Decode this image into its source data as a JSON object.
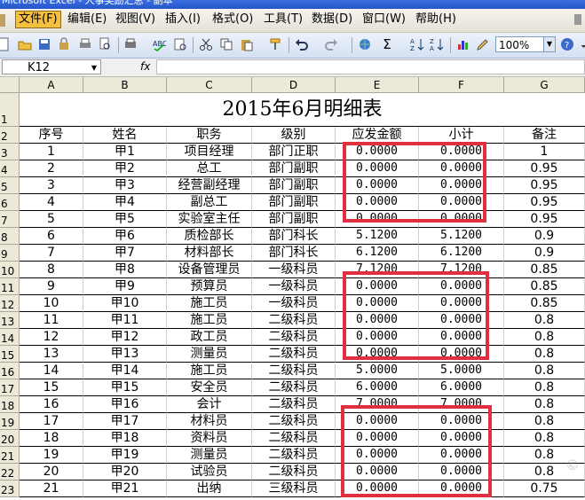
{
  "app": {
    "title": "Microsoft Excel - 人事奖励汇总 - 副本"
  },
  "menu": [
    "文件(F)",
    "编辑(E)",
    "视图(V)",
    "插入(I)",
    "格式(O)",
    "工具(T)",
    "数据(D)",
    "窗口(W)",
    "帮助(H)"
  ],
  "toolbar": {
    "zoom": "100%"
  },
  "formula": {
    "name_box": "K12",
    "fx": "fx",
    "value": ""
  },
  "columns": [
    "A",
    "B",
    "C",
    "D",
    "E",
    "F",
    "G"
  ],
  "sheet": {
    "title": "2015年6月明细表",
    "headers": [
      "序号",
      "姓名",
      "职务",
      "级别",
      "应发金额",
      "小计",
      "备注"
    ],
    "rows": [
      [
        "1",
        "甲1",
        "项目经理",
        "部门正职",
        "0.0000",
        "0.0000",
        "1"
      ],
      [
        "2",
        "甲2",
        "总工",
        "部门副职",
        "0.0000",
        "0.0000",
        "0.95"
      ],
      [
        "3",
        "甲3",
        "经营副经理",
        "部门副职",
        "0.0000",
        "0.0000",
        "0.95"
      ],
      [
        "4",
        "甲4",
        "副总工",
        "部门副职",
        "0.0000",
        "0.0000",
        "0.95"
      ],
      [
        "5",
        "甲5",
        "实验室主任",
        "部门副职",
        "0.0000",
        "0.0000",
        "0.95"
      ],
      [
        "6",
        "甲6",
        "质检部长",
        "部门科长",
        "5.1200",
        "5.1200",
        "0.9"
      ],
      [
        "7",
        "甲7",
        "材料部长",
        "部门科长",
        "6.1200",
        "6.1200",
        "0.9"
      ],
      [
        "8",
        "甲8",
        "设备管理员",
        "一级科员",
        "7.1200",
        "7.1200",
        "0.85"
      ],
      [
        "9",
        "甲9",
        "预算员",
        "一级科员",
        "0.0000",
        "0.0000",
        "0.85"
      ],
      [
        "10",
        "甲10",
        "施工员",
        "一级科员",
        "0.0000",
        "0.0000",
        "0.85"
      ],
      [
        "11",
        "甲11",
        "施工员",
        "二级科员",
        "0.0000",
        "0.0000",
        "0.8"
      ],
      [
        "12",
        "甲12",
        "政工员",
        "二级科员",
        "0.0000",
        "0.0000",
        "0.8"
      ],
      [
        "13",
        "甲13",
        "测量员",
        "二级科员",
        "0.0000",
        "0.0000",
        "0.8"
      ],
      [
        "14",
        "甲14",
        "施工员",
        "二级科员",
        "5.0000",
        "5.0000",
        "0.8"
      ],
      [
        "15",
        "甲15",
        "安全员",
        "二级科员",
        "6.0000",
        "6.0000",
        "0.8"
      ],
      [
        "16",
        "甲16",
        "会计",
        "二级科员",
        "7.0000",
        "7.0000",
        "0.8"
      ],
      [
        "17",
        "甲17",
        "材料员",
        "二级科员",
        "0.0000",
        "0.0000",
        "0.8"
      ],
      [
        "18",
        "甲18",
        "资料员",
        "二级科员",
        "0.0000",
        "0.0000",
        "0.8"
      ],
      [
        "19",
        "甲19",
        "测量员",
        "二级科员",
        "0.0000",
        "0.0000",
        "0.8"
      ],
      [
        "20",
        "甲20",
        "试验员",
        "二级科员",
        "0.0000",
        "0.0000",
        "0.8"
      ],
      [
        "21",
        "甲21",
        "出纳",
        "三级科员",
        "0.0000",
        "0.0000",
        "0.75"
      ]
    ]
  },
  "colors": {
    "highlight_box": "#e03040",
    "header_bg": "#ece9d8",
    "menu_active": "#f5c040"
  }
}
